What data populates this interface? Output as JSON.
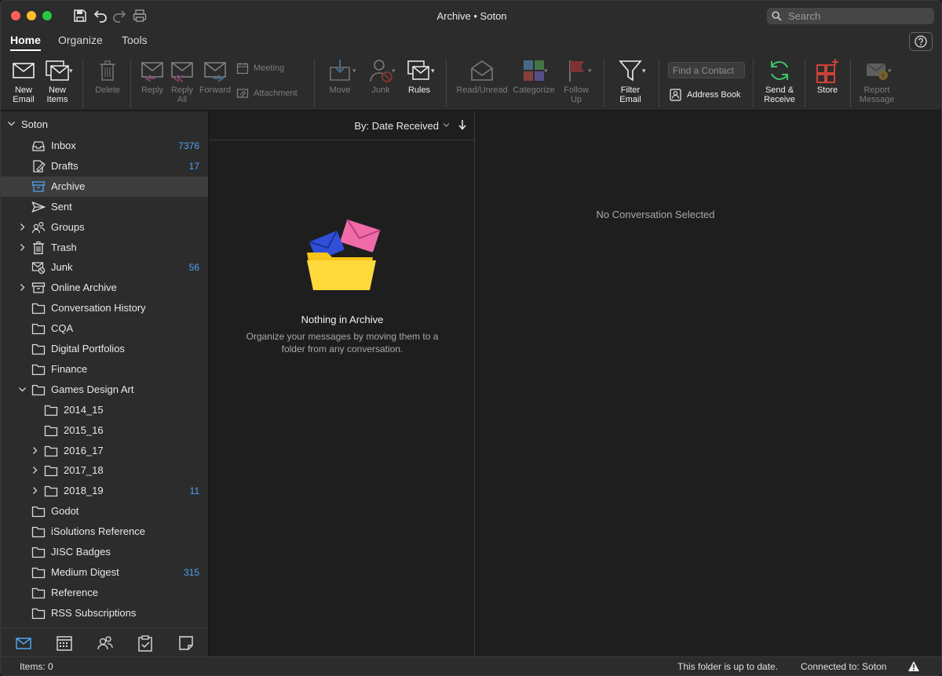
{
  "window": {
    "title": "Archive • Soton"
  },
  "search": {
    "placeholder": "Search"
  },
  "tabs": [
    {
      "label": "Home",
      "active": true
    },
    {
      "label": "Organize",
      "active": false
    },
    {
      "label": "Tools",
      "active": false
    }
  ],
  "ribbon": {
    "new_email": "New\nEmail",
    "new_items": "New\nItems",
    "delete": "Delete",
    "reply": "Reply",
    "reply_all": "Reply\nAll",
    "forward": "Forward",
    "meeting": "Meeting",
    "attachment": "Attachment",
    "move": "Move",
    "junk": "Junk",
    "rules": "Rules",
    "read_unread": "Read/Unread",
    "categorize": "Categorize",
    "follow_up": "Follow\nUp",
    "filter_email": "Filter\nEmail",
    "find_contact_placeholder": "Find a Contact",
    "address_book": "Address Book",
    "send_receive": "Send &\nReceive",
    "store": "Store",
    "report_message": "Report\nMessage"
  },
  "sidebar": {
    "account": "Soton",
    "folders": [
      {
        "name": "Inbox",
        "count": "7376",
        "icon": "inbox-icon"
      },
      {
        "name": "Drafts",
        "count": "17",
        "icon": "drafts-icon"
      },
      {
        "name": "Archive",
        "count": "",
        "icon": "archive-icon",
        "selected": true
      },
      {
        "name": "Sent",
        "count": "",
        "icon": "sent-icon"
      },
      {
        "name": "Groups",
        "count": "",
        "icon": "groups-icon",
        "expandable": true
      },
      {
        "name": "Trash",
        "count": "",
        "icon": "trash-icon",
        "expandable": true
      },
      {
        "name": "Junk",
        "count": "56",
        "icon": "junk-icon"
      },
      {
        "name": "Online Archive",
        "count": "",
        "icon": "archive-icon",
        "expandable": true
      },
      {
        "name": "Conversation History",
        "count": "",
        "icon": "folder-icon"
      },
      {
        "name": "CQA",
        "count": "",
        "icon": "folder-icon"
      },
      {
        "name": "Digital Portfolios",
        "count": "",
        "icon": "folder-icon"
      },
      {
        "name": "Finance",
        "count": "",
        "icon": "folder-icon"
      },
      {
        "name": "Games Design Art",
        "count": "",
        "icon": "folder-icon",
        "expanded": true
      },
      {
        "name": "2014_15",
        "count": "",
        "icon": "folder-icon",
        "child": true
      },
      {
        "name": "2015_16",
        "count": "",
        "icon": "folder-icon",
        "child": true
      },
      {
        "name": "2016_17",
        "count": "",
        "icon": "folder-icon",
        "child": true,
        "expandable": true
      },
      {
        "name": "2017_18",
        "count": "",
        "icon": "folder-icon",
        "child": true,
        "expandable": true
      },
      {
        "name": "2018_19",
        "count": "11",
        "icon": "folder-icon",
        "child": true,
        "expandable": true
      },
      {
        "name": "Godot",
        "count": "",
        "icon": "folder-icon"
      },
      {
        "name": "iSolutions Reference",
        "count": "",
        "icon": "folder-icon"
      },
      {
        "name": "JISC Badges",
        "count": "",
        "icon": "folder-icon"
      },
      {
        "name": "Medium Digest",
        "count": "315",
        "icon": "folder-icon"
      },
      {
        "name": "Reference",
        "count": "",
        "icon": "folder-icon"
      },
      {
        "name": "RSS Subscriptions",
        "count": "",
        "icon": "folder-icon"
      }
    ]
  },
  "bottom_nav": [
    "mail-icon",
    "calendar-icon",
    "people-icon",
    "tasks-icon",
    "notes-icon"
  ],
  "message_list": {
    "sort_label": "By: Date Received",
    "empty_title": "Nothing in Archive",
    "empty_description": "Organize your messages by moving them to a folder from any conversation."
  },
  "reading_pane": {
    "placeholder": "No Conversation Selected"
  },
  "status": {
    "items": "Items: 0",
    "up_to_date": "This folder is up to date.",
    "connection": "Connected to: Soton"
  },
  "colors": {
    "accent": "#4ea3f5",
    "background": "#1e1e1e",
    "panel": "#2c2c2c"
  }
}
